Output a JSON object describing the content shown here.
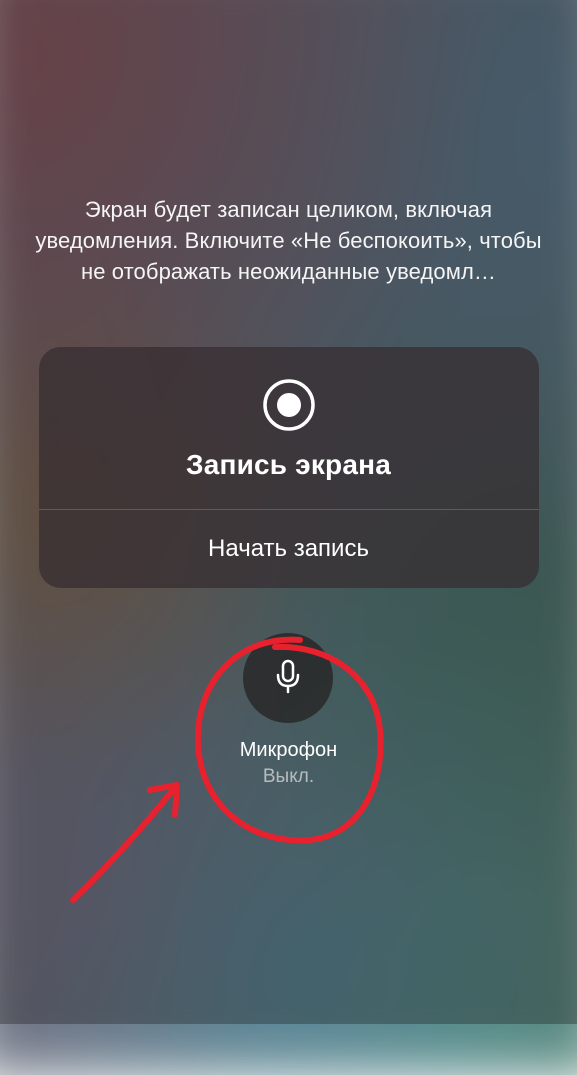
{
  "instruction": "Экран будет записан целиком, включая уведомления. Включите «Не беспокоить», чтобы не отображать неожиданные уведомл…",
  "panel": {
    "title": "Запись экрана",
    "start_button": "Начать запись"
  },
  "microphone": {
    "label": "Микрофон",
    "status": "Выкл."
  }
}
